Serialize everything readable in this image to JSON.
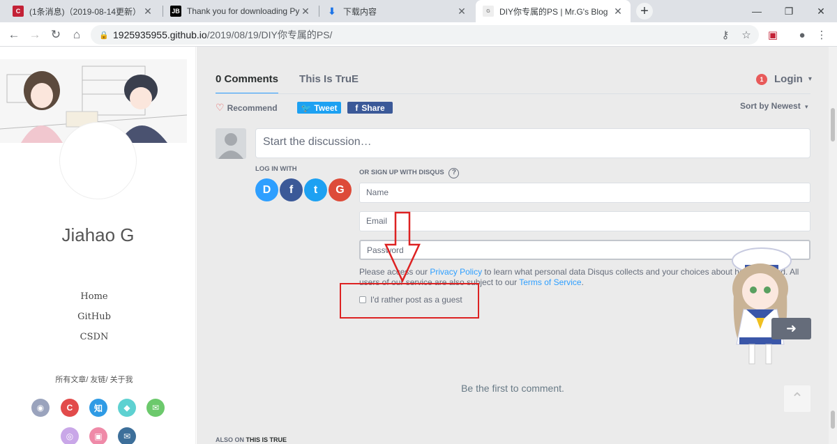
{
  "browser": {
    "tabs": [
      {
        "title": "(1条消息)（2019-08-14更新）",
        "favicon": "csdn-icon",
        "color": "#c32136"
      },
      {
        "title": "Thank you for downloading Py",
        "favicon": "jetbrains-icon",
        "color": "#000000"
      },
      {
        "title": "下载内容",
        "favicon": "download-icon",
        "color": "#1a73e8"
      },
      {
        "title": "DIY你专属的PS | Mr.G's Blog",
        "favicon": "blog-icon",
        "color": "#888888"
      }
    ],
    "new_tab_label": "+",
    "url_host": "1925935955.github.io",
    "url_path": "/2019/08/19/DIY你专属的PS/"
  },
  "sidebar": {
    "author": "Jiahao G",
    "nav": [
      "Home",
      "GitHub",
      "CSDN"
    ],
    "links": "所有文章/ 友链/ 关于我",
    "social": [
      {
        "name": "github-icon",
        "glyph": "◉",
        "color": "#9aa3bd"
      },
      {
        "name": "csdn-icon",
        "glyph": "C",
        "color": "#e24b4b"
      },
      {
        "name": "zhihu-icon",
        "glyph": "知",
        "color": "#2f9be5"
      },
      {
        "name": "qq-icon",
        "glyph": "◆",
        "color": "#5ed1d1"
      },
      {
        "name": "wechat-icon",
        "glyph": "✉",
        "color": "#6cc96c"
      },
      {
        "name": "weibo-icon",
        "glyph": "◎",
        "color": "#c9a7e8"
      },
      {
        "name": "bilibili-icon",
        "glyph": "▣",
        "color": "#ef8aa8"
      },
      {
        "name": "email-icon",
        "glyph": "✉",
        "color": "#3d6f9a"
      }
    ]
  },
  "disqus": {
    "tab_comments": "0 Comments",
    "tab_site": "This Is TruE",
    "login_badge": "1",
    "login_label": "Login",
    "recommend": "Recommend",
    "tweet": "Tweet",
    "share": "Share",
    "sort_by": "Sort by Newest",
    "compose_placeholder": "Start the discussion…",
    "login_with": "LOG IN WITH",
    "signup_with": "OR SIGN UP WITH DISQUS",
    "providers": [
      {
        "name": "disqus-login-icon",
        "glyph": "D",
        "color": "#2e9fff"
      },
      {
        "name": "facebook-login-icon",
        "glyph": "f",
        "color": "#3b5998"
      },
      {
        "name": "twitter-login-icon",
        "glyph": "t",
        "color": "#1da1f2"
      },
      {
        "name": "google-login-icon",
        "glyph": "G",
        "color": "#dd4b39"
      }
    ],
    "name_placeholder": "Name",
    "email_placeholder": "Email",
    "password_placeholder": "Password",
    "policy_pre": "Please access our ",
    "policy_link": "Privacy Policy",
    "policy_mid": " to learn what personal data Disqus collects and your choices about how it is used. All users of our service are also subject to our ",
    "terms_link": "Terms of Service",
    "policy_end": ".",
    "guest_label": "I'd rather post as a guest",
    "empty_state": "Be the first to comment.",
    "also_on_prefix": "ALSO ON ",
    "also_on_site": "THIS IS TRUE"
  }
}
